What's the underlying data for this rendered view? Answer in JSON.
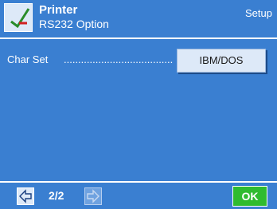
{
  "header": {
    "title": "Printer",
    "subtitle": "RS232 Option",
    "section": "Setup",
    "icon": "checkmark-icon"
  },
  "setting": {
    "label": "Char Set",
    "leader": "................................................",
    "value": "IBM/DOS"
  },
  "footer": {
    "page": "2/2",
    "ok_label": "OK",
    "prev_icon": "arrow-left-icon",
    "next_icon": "arrow-right-icon"
  },
  "colors": {
    "background": "#3a7fd1",
    "button": "#dde9f8",
    "ok": "#2fbb2f"
  }
}
